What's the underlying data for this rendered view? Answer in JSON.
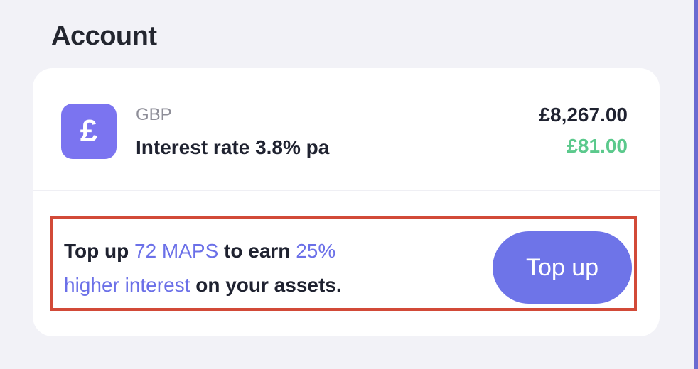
{
  "header": {
    "title": "Account"
  },
  "account": {
    "currency_code": "GBP",
    "currency_icon": "pound-sign-icon",
    "currency_symbol": "£",
    "interest_rate_label": "Interest rate 3.8% pa",
    "balance": "£8,267.00",
    "interest_earned": "£81.00"
  },
  "promo": {
    "text_1": "Top up ",
    "highlight_amount": "72 MAPS",
    "text_2": " to earn ",
    "highlight_percent": "25%",
    "highlight_interest": "higher interest",
    "text_3": " on your assets.",
    "button_label": "Top up"
  },
  "colors": {
    "accent": "#6E74E8",
    "icon_bg": "#7B74F0",
    "positive": "#5BC98C",
    "highlight_border": "#D24A38",
    "background": "#F2F2F7"
  }
}
